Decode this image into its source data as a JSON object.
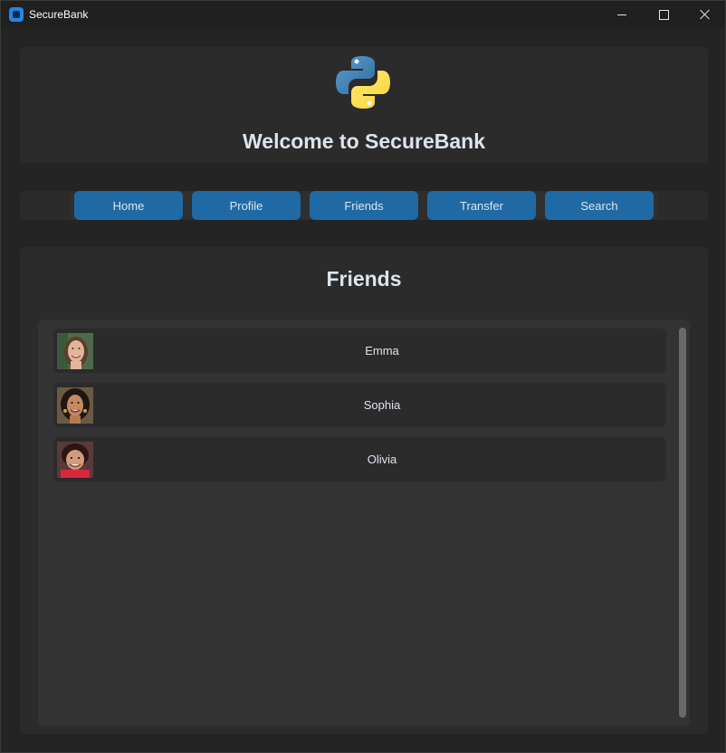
{
  "window": {
    "title": "SecureBank",
    "controls": {
      "minimize": "minimize-icon",
      "maximize": "maximize-icon",
      "close": "close-icon"
    }
  },
  "header": {
    "logo": "python-logo-icon",
    "welcome": "Welcome to SecureBank"
  },
  "nav": {
    "items": [
      {
        "label": "Home"
      },
      {
        "label": "Profile"
      },
      {
        "label": "Friends"
      },
      {
        "label": "Transfer"
      },
      {
        "label": "Search"
      }
    ],
    "button_color": "#1f6aa5"
  },
  "content": {
    "title": "Friends",
    "friends": [
      {
        "name": "Emma"
      },
      {
        "name": "Sophia"
      },
      {
        "name": "Olivia"
      }
    ]
  },
  "colors": {
    "background": "#242424",
    "frame": "#2b2b2b",
    "list": "#333333",
    "accent": "#1f6aa5",
    "text": "#dce4ee"
  }
}
